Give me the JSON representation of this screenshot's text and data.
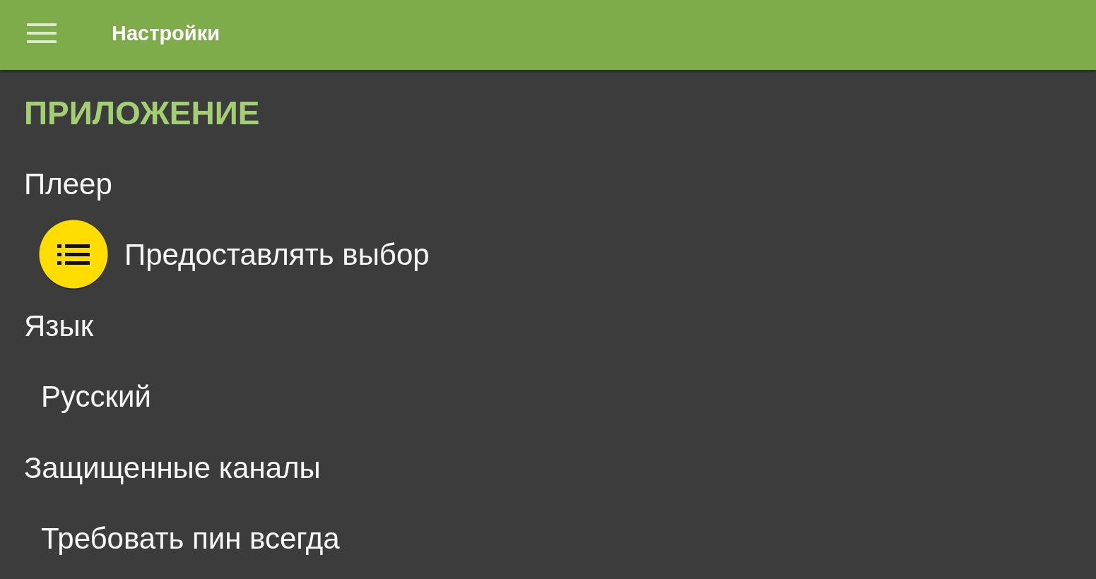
{
  "app_bar": {
    "title": "Настройки"
  },
  "sections": [
    {
      "title": "ПРИЛОЖЕНИЕ",
      "preferences": [
        {
          "title": "Плеер",
          "value": {
            "kind": "badge",
            "text": "Предоставлять выбор"
          }
        },
        {
          "title": "Язык",
          "value": {
            "kind": "plain",
            "text": "Русский"
          }
        },
        {
          "title": "Защищенные каналы",
          "value": {
            "kind": "plain",
            "text": "Требовать пин всегда"
          }
        }
      ]
    }
  ]
}
